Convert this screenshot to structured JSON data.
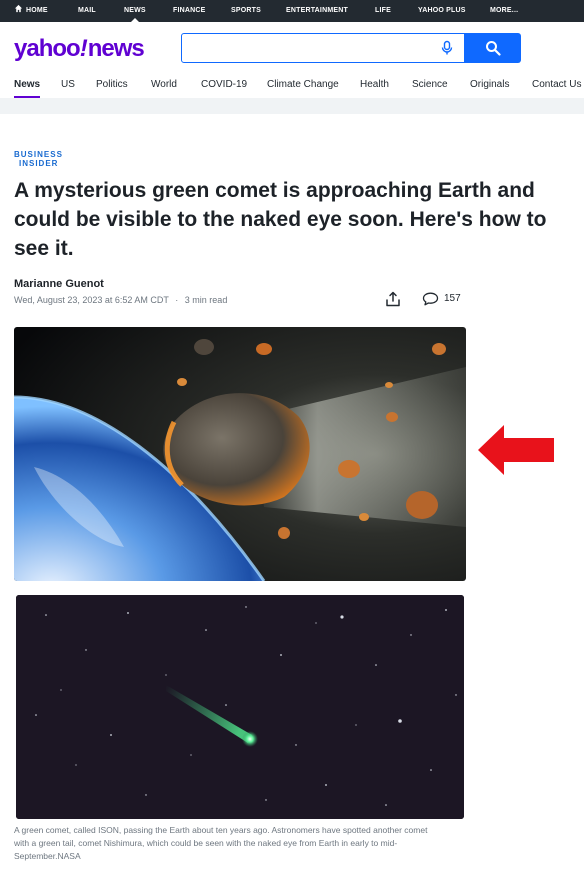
{
  "top_nav": {
    "items": [
      "HOME",
      "MAIL",
      "NEWS",
      "FINANCE",
      "SPORTS",
      "ENTERTAINMENT",
      "LIFE",
      "YAHOO PLUS",
      "MORE..."
    ],
    "active": "NEWS"
  },
  "header": {
    "logo": "yahoo/news",
    "search_value": "",
    "accent": "#6001d2",
    "search_blue": "#0f69ff"
  },
  "category_nav": {
    "items": [
      "News",
      "US",
      "Politics",
      "World",
      "COVID-19",
      "Climate Change",
      "Health",
      "Science",
      "Originals",
      "Contact Us"
    ],
    "active": "News"
  },
  "article": {
    "source_line1": "BUSINESS",
    "source_line2": "INSIDER",
    "headline": "A mysterious green comet is approaching Earth and could be visible to the naked eye soon. Here's how to see it.",
    "author": "Marianne Guenot",
    "date": "Wed, August 23, 2023 at 6:52 AM CDT",
    "read_time": "3 min read",
    "comment_count": "157",
    "image_caption": "A green comet, called ISON, passing the Earth about ten years ago. Astronomers have spotted another comet with a green tail, comet Nishimura, which could be seen with the naked eye from Earth in early to mid-September.NASA"
  },
  "annotation": {
    "arrow_color": "#e8121b"
  }
}
